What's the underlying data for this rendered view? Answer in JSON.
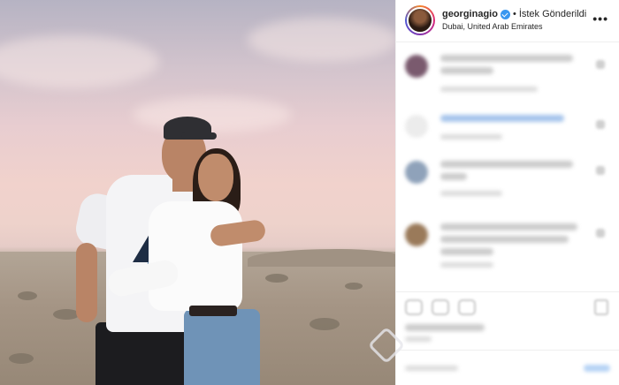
{
  "post": {
    "username": "georginagio",
    "separator": "•",
    "follow_status": "İstek Gönderildi",
    "location": "Dubai, United Arab Emirates",
    "more_label": "•••"
  },
  "colors": {
    "verified": "#3897f0",
    "story_ring": [
      "#f58529",
      "#dd2a7b",
      "#8134af",
      "#515bd4"
    ]
  },
  "icons": {
    "verified": "verified-badge-icon",
    "more": "more-options-icon",
    "like": "heart-icon",
    "comment": "comment-icon",
    "share": "share-icon",
    "save": "bookmark-icon"
  }
}
